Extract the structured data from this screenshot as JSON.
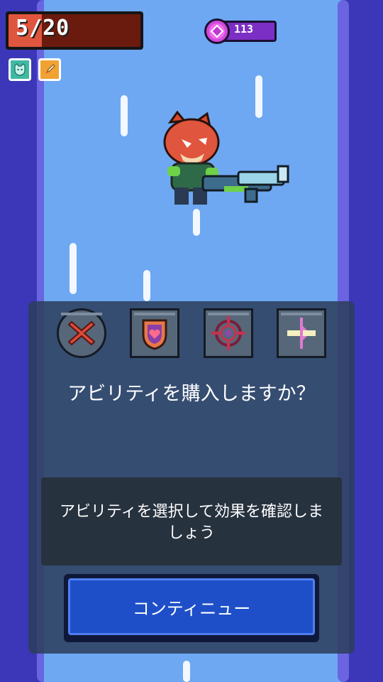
{
  "hud": {
    "hp_text": "5/20",
    "hp_current": 5,
    "hp_max": 20,
    "currency_value": "113",
    "buff_icons": [
      "cat-shield-icon",
      "rocket-icon"
    ]
  },
  "ability_dialog": {
    "slots": [
      {
        "icon": "close-x-icon"
      },
      {
        "icon": "heart-shield-icon"
      },
      {
        "icon": "crosshair-icon"
      },
      {
        "icon": "split-arrow-icon"
      }
    ],
    "question": "アビリティを購入しますか？",
    "info": "アビリティを選択して効果を確認しましょう",
    "continue_label": "コンティニュー"
  },
  "colors": {
    "hp_fill": "#e0553d",
    "hp_empty": "#6b1a0e",
    "currency_pill": "#7c2fc4",
    "button": "#1e4fc8",
    "sky": "#6ea8f2"
  }
}
